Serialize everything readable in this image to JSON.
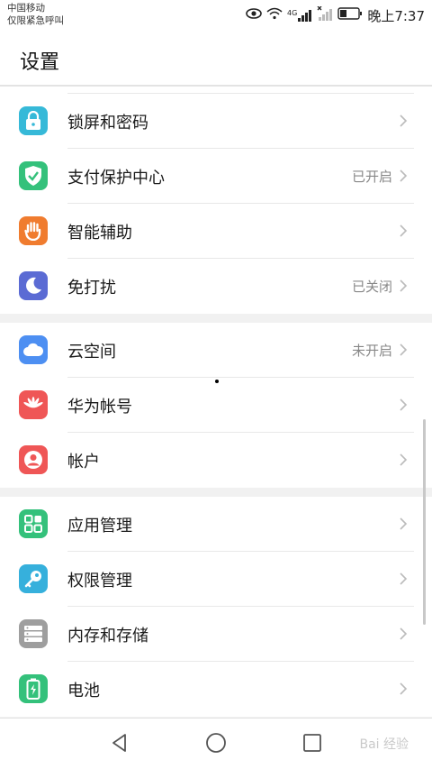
{
  "status_bar": {
    "carrier": "中国移动",
    "emergency": "仅限紧急呼叫",
    "network": "4G",
    "time": "晚上7:37"
  },
  "header": {
    "title": "设置"
  },
  "groups": [
    {
      "items": [
        {
          "label": "锁屏和密码",
          "value": "",
          "icon": "lock-icon",
          "color": "#36b9d8"
        },
        {
          "label": "支付保护中心",
          "value": "已开启",
          "icon": "shield-check-icon",
          "color": "#34c17b"
        },
        {
          "label": "智能辅助",
          "value": "",
          "icon": "hand-icon",
          "color": "#f07c2f"
        },
        {
          "label": "免打扰",
          "value": "已关闭",
          "icon": "moon-icon",
          "color": "#5b6bd4"
        }
      ]
    },
    {
      "items": [
        {
          "label": "云空间",
          "value": "未开启",
          "icon": "cloud-icon",
          "color": "#4d8ff2"
        },
        {
          "label": "华为帐号",
          "value": "",
          "icon": "huawei-logo-icon",
          "color": "#ef5656"
        },
        {
          "label": "帐户",
          "value": "",
          "icon": "user-icon",
          "color": "#ef5656"
        }
      ]
    },
    {
      "items": [
        {
          "label": "应用管理",
          "value": "",
          "icon": "apps-grid-icon",
          "color": "#34c17b"
        },
        {
          "label": "权限管理",
          "value": "",
          "icon": "key-icon",
          "color": "#36b0dc"
        },
        {
          "label": "内存和存储",
          "value": "",
          "icon": "storage-icon",
          "color": "#9e9e9e"
        },
        {
          "label": "电池",
          "value": "",
          "icon": "battery-icon",
          "color": "#34c17b"
        }
      ]
    }
  ],
  "navigation": {
    "back": "back-icon",
    "home": "home-icon",
    "recents": "recents-icon"
  },
  "watermark": "Bai 经验"
}
